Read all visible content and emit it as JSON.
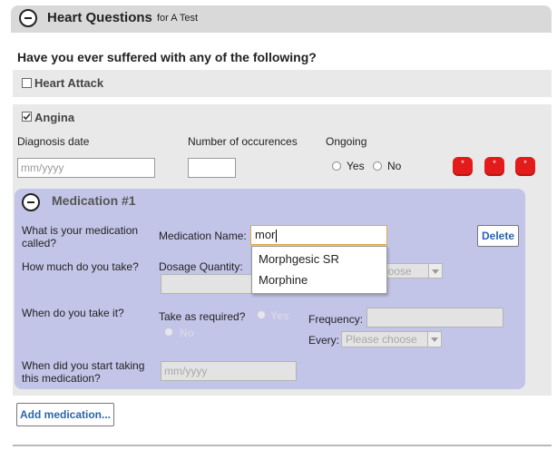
{
  "header": {
    "title": "Heart Questions",
    "subtitle": "for A Test"
  },
  "question": "Have you ever suffered with any of the following?",
  "conditions": [
    {
      "label": "Heart Attack",
      "checked": false
    },
    {
      "label": "Angina",
      "checked": true
    }
  ],
  "angina": {
    "diagnosis_label": "Diagnosis date",
    "diagnosis_placeholder": "mm/yyyy",
    "occurrences_label": "Number of occurences",
    "occurrences_value": "",
    "ongoing_label": "Ongoing",
    "ongoing_yes": "Yes",
    "ongoing_no": "No",
    "required_marks": [
      "*",
      "*",
      "*"
    ]
  },
  "medication": {
    "heading": "Medication #1",
    "q_called": "What is your medication called?",
    "name_label": "Medication Name:",
    "name_value": "mor",
    "delete_label": "Delete",
    "q_how_much": "How much do you take?",
    "dosage_label": "Dosage Quantity:",
    "dosage_select": "choose",
    "q_when": "When do you take it?",
    "as_required_label": "Take as required?",
    "as_required_yes": "Yes",
    "as_required_no": "No",
    "frequency_label": "Frequency:",
    "every_label": "Every:",
    "every_select": "Please choose",
    "q_start": "When did you start taking this medication?",
    "start_placeholder": "mm/yyyy",
    "autocomplete": [
      "Morphgesic SR",
      "Morphine"
    ]
  },
  "add_medication_label": "Add medication...",
  "colors": {
    "header_bg": "#d9d9d9",
    "row_bg": "#e9e9e9",
    "medication_bg": "#c3c5e8",
    "required_red": "#e31b1b",
    "link_blue": "#2b64b0"
  }
}
